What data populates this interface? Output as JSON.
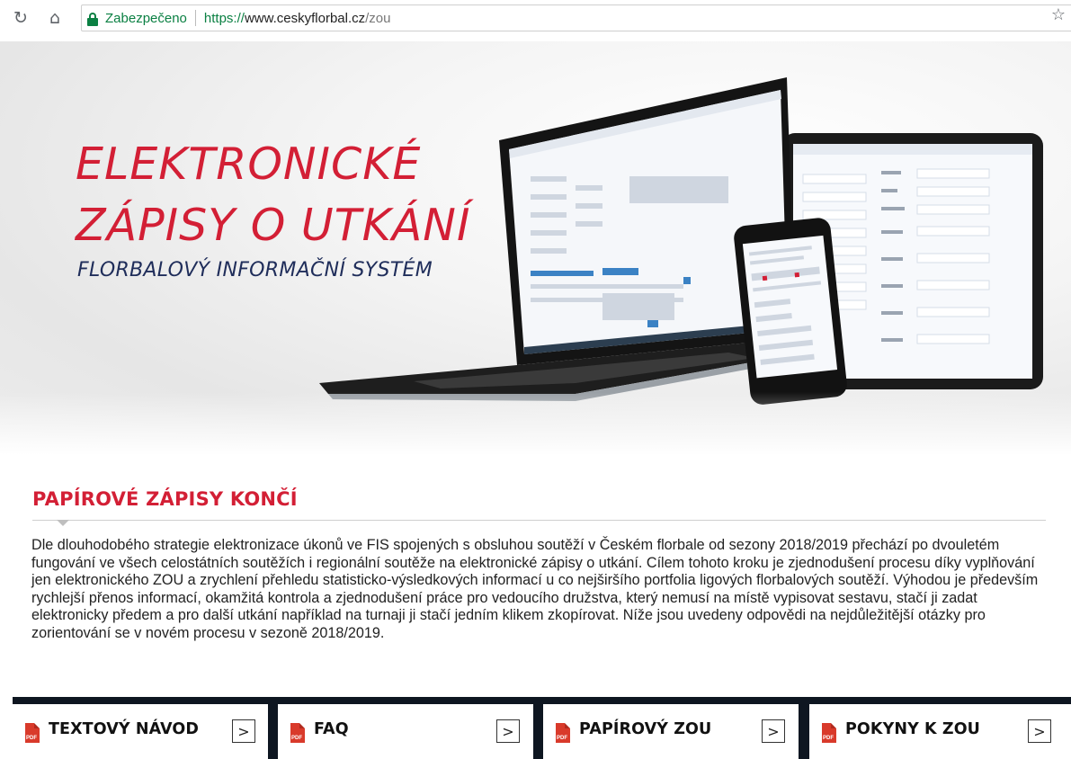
{
  "browser": {
    "reload_icon": "reload-icon",
    "home_icon": "home-icon",
    "secure_label": "Zabezpečeno",
    "url_scheme": "https://",
    "url_host": "www.ceskyflorbal.cz",
    "url_path": "/zou",
    "bookmark_icon": "star-icon"
  },
  "hero": {
    "title_line1": "ELEKTRONICKÉ",
    "title_line2": "ZÁPISY O UTKÁNÍ",
    "subtitle": "FLORBALOVÝ INFORMAČNÍ SYSTÉM"
  },
  "section": {
    "title": "PAPÍROVÉ ZÁPISY KONČÍ",
    "body": "Dle dlouhodobého strategie elektronizace úkonů ve FIS spojených s obsluhou soutěží v Českém florbale od sezony 2018/2019 přechází po dvouletém fungování ve všech celostátních soutěžích i regionální soutěže na elektronické zápisy o utkání. Cílem tohoto kroku je zjednodušení procesu díky vyplňování jen elektronického ZOU a zrychlení přehledu statisticko-výsledkových informací u co nejširšího portfolia ligových florbalových soutěží. Výhodou je především rychlejší přenos informací, okamžitá kontrola a zjednodušení práce pro vedoucího družstva, který nemusí na místě vypisovat sestavu, stačí ji zadat elektronicky předem a pro další utkání například na turnaji ji stačí jedním klikem zkopírovat. Níže jsou uvedeny odpovědi na nejdůležitější otázky pro zorientování se v novém procesu v sezoně 2018/2019."
  },
  "buttons": [
    {
      "label": "TEXTOVÝ NÁVOD",
      "icon": "pdf-icon",
      "arrow": ">"
    },
    {
      "label": "FAQ",
      "icon": "pdf-icon",
      "arrow": ">"
    },
    {
      "label": "PAPÍROVÝ ZOU",
      "icon": "pdf-icon",
      "arrow": ">"
    },
    {
      "label": "POKYNY K ZOU",
      "icon": "pdf-icon",
      "arrow": ">"
    }
  ],
  "colors": {
    "accent_red": "#d31f35",
    "navy": "#1f2d5a",
    "secure_green": "#0b8043",
    "footer_bar": "#0e1621"
  }
}
